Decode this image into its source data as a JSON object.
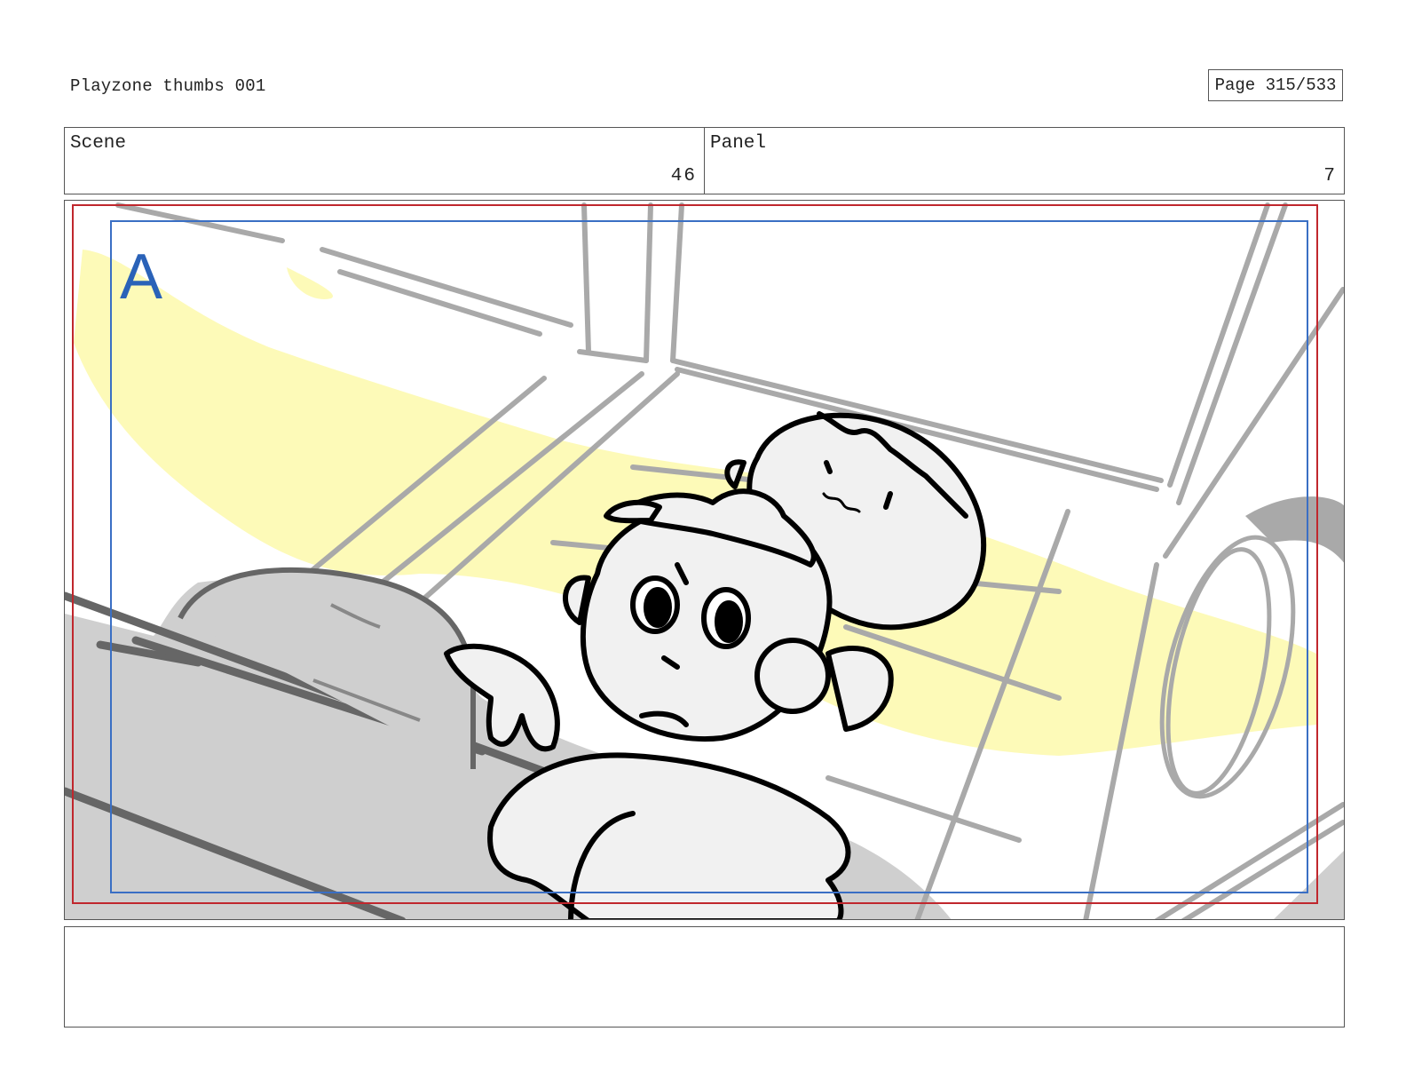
{
  "header": {
    "doc_title": "Playzone thumbs 001",
    "page_indicator": "Page 315/533"
  },
  "meta": {
    "scene_label": "Scene",
    "scene_value": "46",
    "panel_label": "Panel",
    "panel_value": "7"
  },
  "panel_art": {
    "frame_marker": "A",
    "colors": {
      "safe_frame": "#c0272d",
      "title_safe": "#3a6fc4",
      "marker": "#2a62b8",
      "highlight": "#fdfab8",
      "sketch_gray": "#a9a9a9",
      "fill_gray": "#cfcfcf",
      "character_fill": "#f1f1f1"
    }
  },
  "notes": {
    "text": ""
  }
}
